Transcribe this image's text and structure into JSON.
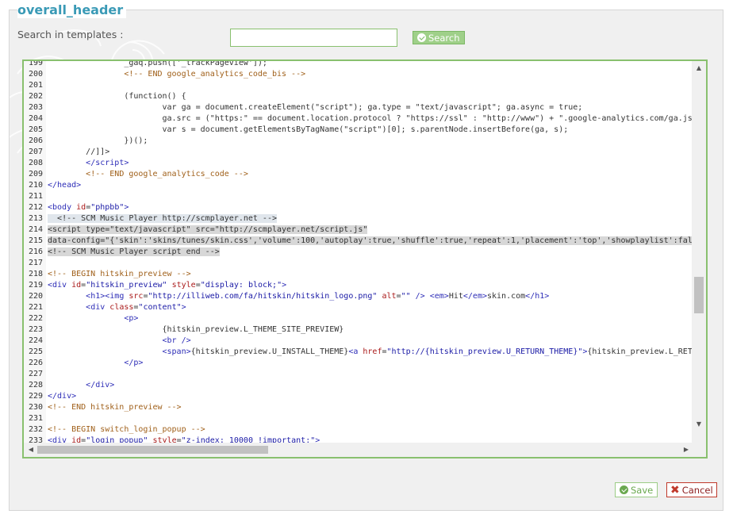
{
  "header": {
    "title": "overall_header"
  },
  "search": {
    "label": "Search in templates :",
    "value": "",
    "placeholder": "",
    "button_label": "Search"
  },
  "editor": {
    "lines": [
      {
        "n": "199",
        "html": "                <span class='d'>_gaq.push(['_trackPageview']);</span>"
      },
      {
        "n": "200",
        "html": "                <span class='c'>&lt;!-- END google_analytics_code_bis --&gt;</span>"
      },
      {
        "n": "201",
        "html": ""
      },
      {
        "n": "202",
        "html": "                <span class='d'>(function() {</span>"
      },
      {
        "n": "203",
        "html": "                        <span class='d'>var ga = document.createElement(\"script\"); ga.type = \"text/javascript\"; ga.async = true;</span>"
      },
      {
        "n": "204",
        "html": "                        <span class='d'>ga.src = (\"https:\" == document.location.protocol ? \"https://ssl\" : \"http://www\") + \".google-analytics.com/ga.js\";</span>"
      },
      {
        "n": "205",
        "html": "                        <span class='d'>var s = document.getElementsByTagName(\"script\")[0]; s.parentNode.insertBefore(ga, s);</span>"
      },
      {
        "n": "206",
        "html": "                <span class='d'>})();</span>"
      },
      {
        "n": "207",
        "html": "        <span class='d'>//]]&gt;</span>"
      },
      {
        "n": "208",
        "html": "        <span class='t'>&lt;/script&gt;</span>"
      },
      {
        "n": "209",
        "html": "        <span class='c'>&lt;!-- END google_analytics_code --&gt;</span>"
      },
      {
        "n": "210",
        "html": "<span class='t'>&lt;/head&gt;</span>"
      },
      {
        "n": "211",
        "html": ""
      },
      {
        "n": "212",
        "html": "<span class='t'>&lt;body</span> <span class='a'>id</span>=<span class='s'>\"phpbb\"</span><span class='t'>&gt;</span>"
      },
      {
        "n": "213",
        "html": "  <span class='d'>&lt;!-- SCM Music Player http://scmplayer.net --&gt;</span>",
        "sel": "sel1"
      },
      {
        "n": "214",
        "html": "<span class='d'>&lt;script type=\"text/javascript\" src=\"http://scmplayer.net/script.js\"</span>",
        "sel": "sel"
      },
      {
        "n": "215",
        "html": "<span class='d'>data-config=\"{'skin':'skins/tunes/skin.css','volume':100,'autoplay':true,'shuffle':true,'repeat':1,'placement':'top','showplaylist':false}\"</span>",
        "sel": "sel"
      },
      {
        "n": "216",
        "html": "<span class='d'>&lt;!-- SCM Music Player script end --&gt;</span>",
        "sel": "sel"
      },
      {
        "n": "217",
        "html": ""
      },
      {
        "n": "218",
        "html": "<span class='c'>&lt;!-- BEGIN hitskin_preview --&gt;</span>"
      },
      {
        "n": "219",
        "html": "<span class='t'>&lt;div</span> <span class='a'>id</span>=<span class='s'>\"hitskin_preview\"</span> <span class='a'>style</span>=<span class='s'>\"display: block;\"</span><span class='t'>&gt;</span>"
      },
      {
        "n": "220",
        "html": "        <span class='t'>&lt;h1&gt;&lt;img</span> <span class='a'>src</span>=<span class='s'>\"http://illiweb.com/fa/hitskin/hitskin_logo.png\"</span> <span class='a'>alt</span>=<span class='s'>\"\"</span> <span class='t'>/&gt;</span> <span class='t'>&lt;em&gt;</span>Hit<span class='t'>&lt;/em&gt;</span>skin.com<span class='t'>&lt;/h1&gt;</span>"
      },
      {
        "n": "221",
        "html": "        <span class='t'>&lt;div</span> <span class='a'>class</span>=<span class='s'>\"content\"</span><span class='t'>&gt;</span>"
      },
      {
        "n": "222",
        "html": "                <span class='t'>&lt;p&gt;</span>"
      },
      {
        "n": "223",
        "html": "                        <span class='d'>{hitskin_preview.L_THEME_SITE_PREVIEW}</span>"
      },
      {
        "n": "224",
        "html": "                        <span class='t'>&lt;br /&gt;</span>"
      },
      {
        "n": "225",
        "html": "                        <span class='t'>&lt;span&gt;</span>{hitskin_preview.U_INSTALL_THEME}<span class='t'>&lt;a</span> <span class='a'>href</span>=<span class='s'>\"http://{hitskin_preview.U_RETURN_THEME}\"</span><span class='t'>&gt;</span>{hitskin_preview.L_RETURN_THEME}"
      },
      {
        "n": "226",
        "html": "                <span class='t'>&lt;/p&gt;</span>"
      },
      {
        "n": "227",
        "html": ""
      },
      {
        "n": "228",
        "html": "        <span class='t'>&lt;/div&gt;</span>"
      },
      {
        "n": "229",
        "html": "<span class='t'>&lt;/div&gt;</span>"
      },
      {
        "n": "230",
        "html": "<span class='c'>&lt;!-- END hitskin_preview --&gt;</span>"
      },
      {
        "n": "231",
        "html": ""
      },
      {
        "n": "232",
        "html": "<span class='c'>&lt;!-- BEGIN switch_login_popup --&gt;</span>"
      },
      {
        "n": "233",
        "html": "<span class='t'>&lt;div</span> <span class='a'>id</span>=<span class='s'>\"login_popup\"</span> <span class='a'>style</span>=<span class='s'>\"z-index: 10000 !important;\"</span><span class='t'>&gt;</span>"
      }
    ]
  },
  "footer": {
    "save_label": "Save",
    "cancel_label": "Cancel"
  },
  "colors": {
    "accent": "#3a9ab6",
    "green": "#89c06e",
    "cancel": "#c0392b"
  },
  "icons": {
    "search_button": "check-circle-icon",
    "save_button": "check-circle-icon",
    "cancel_button": "close-x-icon"
  }
}
